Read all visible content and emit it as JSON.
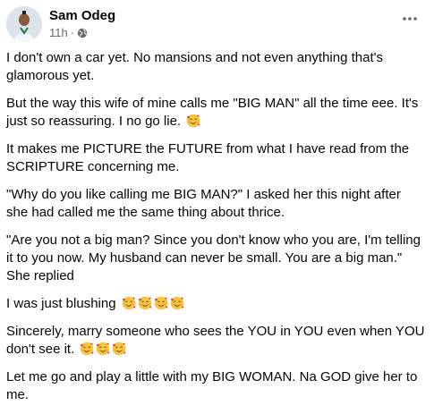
{
  "post": {
    "author": "Sam Odeg",
    "time": "11h",
    "separator": "·",
    "privacy_icon": "globe-icon",
    "more_icon": "more-options-icon",
    "paragraphs": [
      {
        "text": "I don't own a car yet. No mansions and not even anything that's glamorous yet.",
        "emojis": 0
      },
      {
        "text": "But the way this wife of mine calls me \"BIG MAN\" all the time eee. It's just so reassuring. I no go lie.",
        "emojis": 1
      },
      {
        "text": "It makes me PICTURE the FUTURE from what I have read from the SCRIPTURE concerning me.",
        "emojis": 0
      },
      {
        "text": "\"Why do you like calling me BIG MAN?\" I asked her this night after she had called me the same thing about thrice.",
        "emojis": 0
      },
      {
        "text": "\"Are you not a big man? Since you don't know who you are, I'm telling it to you now. My husband can never be small. You are a big man.\" She replied",
        "emojis": 0
      },
      {
        "text": "I was just blushing",
        "emojis": 4
      },
      {
        "text": "Sincerely, marry someone who sees the YOU in YOU even when YOU don't see it.",
        "emojis": 3
      },
      {
        "text": "Let me go and play a little with my BIG WOMAN. Na GOD give her to me.",
        "emojis": 0
      }
    ],
    "emoji_icon": "smiling-face-with-hearts-icon"
  }
}
